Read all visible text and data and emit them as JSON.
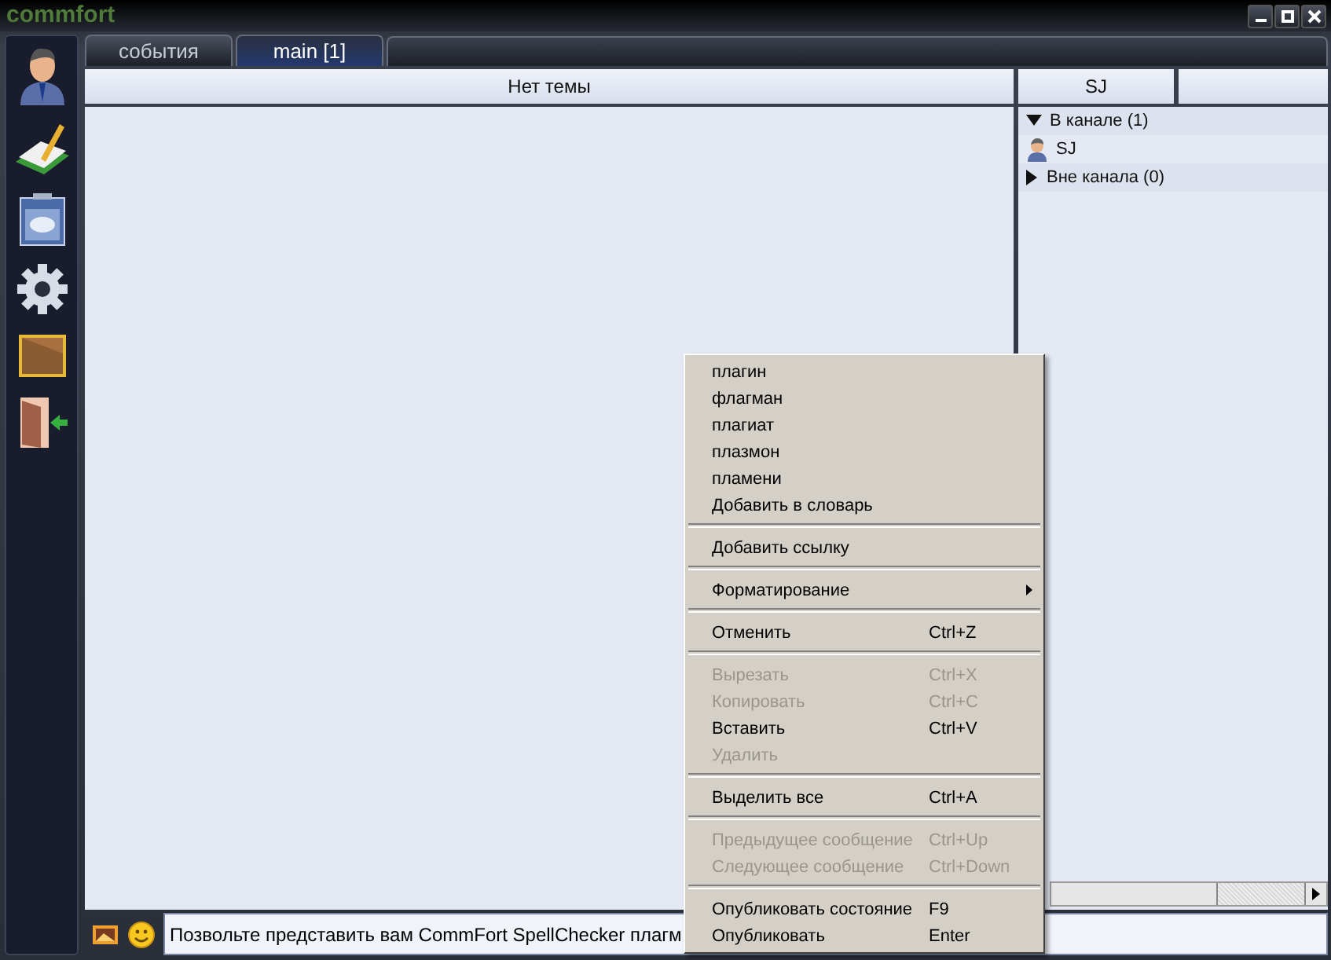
{
  "window": {
    "title": "commfort"
  },
  "tabs": [
    {
      "label": "события",
      "selected": false
    },
    {
      "label": "main [1]",
      "selected": true
    }
  ],
  "header": {
    "topic": "Нет темы",
    "user_column": "SJ"
  },
  "users": [
    {
      "kind": "group",
      "label": "В канале (1)",
      "expanded": true
    },
    {
      "kind": "user",
      "label": "SJ"
    },
    {
      "kind": "group",
      "label": "Вне канала (0)",
      "expanded": false
    }
  ],
  "input": {
    "value": "Позвольте представить вам CommFort SpellChecker плагм"
  },
  "context_menu": [
    {
      "kind": "item",
      "label": "плагин",
      "disabled": false
    },
    {
      "kind": "item",
      "label": "флагман",
      "disabled": false
    },
    {
      "kind": "item",
      "label": "плагиат",
      "disabled": false
    },
    {
      "kind": "item",
      "label": "плазмон",
      "disabled": false
    },
    {
      "kind": "item",
      "label": "пламени",
      "disabled": false
    },
    {
      "kind": "item",
      "label": "Добавить в словарь",
      "disabled": false
    },
    {
      "kind": "separator"
    },
    {
      "kind": "item",
      "label": "Добавить ссылку",
      "disabled": false
    },
    {
      "kind": "separator"
    },
    {
      "kind": "submenu",
      "label": "Форматирование",
      "disabled": false
    },
    {
      "kind": "separator"
    },
    {
      "kind": "item",
      "label": "Отменить",
      "shortcut": "Ctrl+Z",
      "disabled": false
    },
    {
      "kind": "separator"
    },
    {
      "kind": "item",
      "label": "Вырезать",
      "shortcut": "Ctrl+X",
      "disabled": true
    },
    {
      "kind": "item",
      "label": "Копировать",
      "shortcut": "Ctrl+C",
      "disabled": true
    },
    {
      "kind": "item",
      "label": "Вставить",
      "shortcut": "Ctrl+V",
      "disabled": false
    },
    {
      "kind": "item",
      "label": "Удалить",
      "disabled": true
    },
    {
      "kind": "separator"
    },
    {
      "kind": "item",
      "label": "Выделить все",
      "shortcut": "Ctrl+A",
      "disabled": false
    },
    {
      "kind": "separator"
    },
    {
      "kind": "item",
      "label": "Предыдущее сообщение",
      "shortcut": "Ctrl+Up",
      "disabled": true
    },
    {
      "kind": "item",
      "label": "Следующее сообщение",
      "shortcut": "Ctrl+Down",
      "disabled": true
    },
    {
      "kind": "separator"
    },
    {
      "kind": "item",
      "label": "Опубликовать состояние",
      "shortcut": "F9",
      "disabled": false
    },
    {
      "kind": "item",
      "label": "Опубликовать",
      "shortcut": "Enter",
      "disabled": false
    }
  ]
}
